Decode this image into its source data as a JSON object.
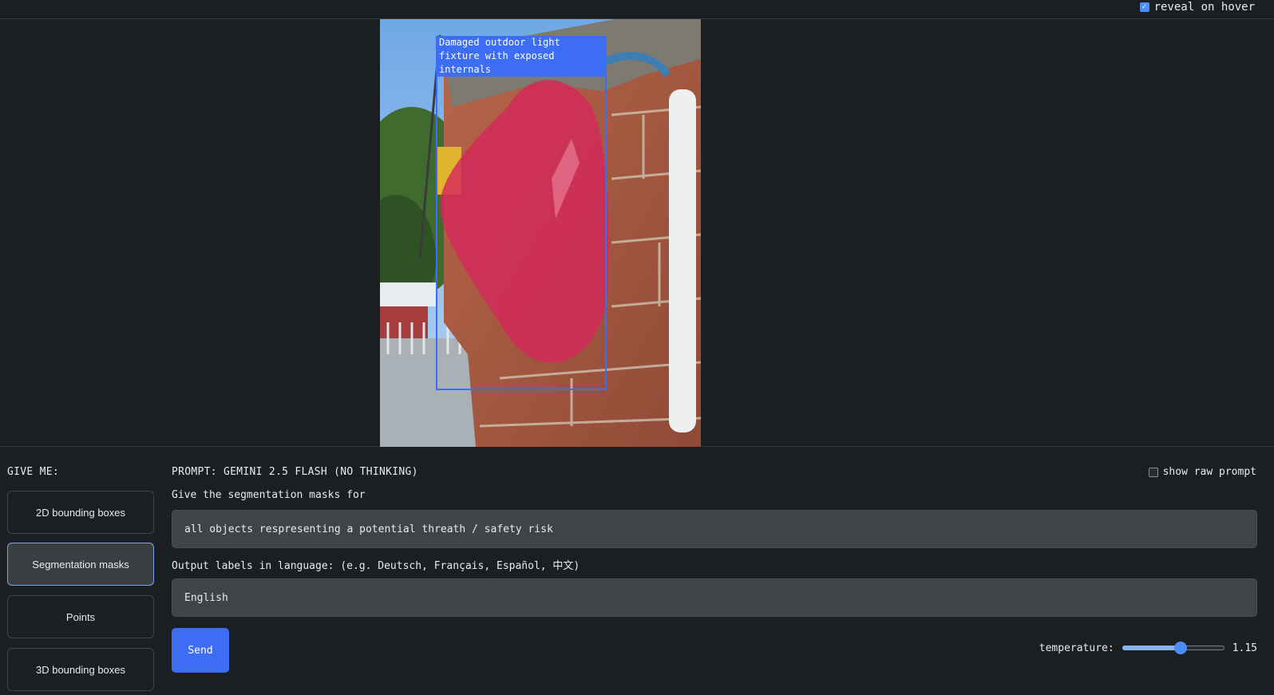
{
  "header": {
    "reveal_on_hover": {
      "label": "reveal on hover",
      "checked": true
    }
  },
  "image": {
    "label": "Damaged outdoor light\nfixture with exposed\ninternals",
    "box_color": "#3d6df2",
    "mask_color": "#d4285a"
  },
  "give_me": {
    "title": "GIVE ME:",
    "options": [
      {
        "label": "2D bounding boxes",
        "active": false
      },
      {
        "label": "Segmentation masks",
        "active": true
      },
      {
        "label": "Points",
        "active": false
      },
      {
        "label": "3D bounding boxes",
        "active": false
      }
    ]
  },
  "prompt": {
    "title": "PROMPT: GEMINI 2.5 FLASH (NO THINKING)",
    "show_raw_prompt": {
      "label": "show raw prompt",
      "checked": false
    },
    "instruction": "Give the segmentation masks for",
    "query_value": "all objects respresenting a potential threath / safety risk",
    "language_label": "Output labels in language: (e.g. Deutsch, Français, Español, 中文)",
    "language_value": "English",
    "send_label": "Send",
    "temperature": {
      "label": "temperature:",
      "value": 1.15,
      "display": "1.15",
      "min": 0,
      "max": 2
    }
  },
  "colors": {
    "accent": "#3d6df2",
    "background": "#1c1f22",
    "field": "#404449"
  }
}
